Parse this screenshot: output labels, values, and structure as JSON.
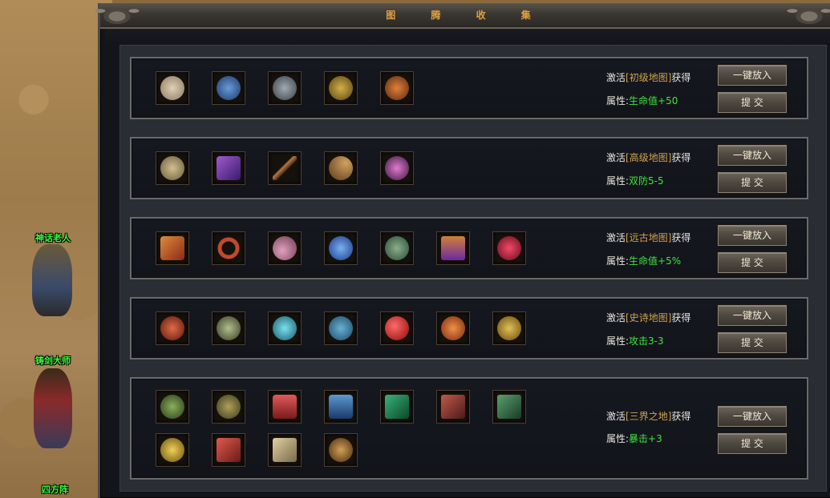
{
  "window": {
    "title": "图 腾 收 集"
  },
  "npcs": [
    {
      "name": "神话老人"
    },
    {
      "name": "铸剑大师"
    },
    {
      "name": "四方阵"
    }
  ],
  "labels": {
    "activate_prefix": "激活",
    "activate_suffix": "获得",
    "attr_prefix": "属性:"
  },
  "buttons": {
    "put_all": "一键放入",
    "submit": "提 交"
  },
  "sections": [
    {
      "map": "[初级地图]",
      "attr": "生命值+50",
      "items": [
        {
          "icon": "bone-icon",
          "color": "#c8b49a"
        },
        {
          "icon": "dragon-claw-icon",
          "color": "#3d6fb0"
        },
        {
          "icon": "claw-icon",
          "color": "#7a8590"
        },
        {
          "icon": "golden-beast-icon",
          "color": "#a88a2a"
        },
        {
          "icon": "eye-icon",
          "color": "#b0602a"
        }
      ]
    },
    {
      "map": "[高级地图]",
      "attr": "双防5-5",
      "items": [
        {
          "icon": "spiral-icon",
          "color": "#a09070"
        },
        {
          "icon": "scroll-icon",
          "color": "#7a3aa8"
        },
        {
          "icon": "sword-icon",
          "color": "#8a5a32"
        },
        {
          "icon": "horn-icon",
          "color": "#9a7a4a"
        },
        {
          "icon": "mask-icon",
          "color": "#b05aa8"
        }
      ]
    },
    {
      "map": "[远古地图]",
      "attr": "生命值+5%",
      "items": [
        {
          "icon": "red-scroll-icon",
          "color": "#c0502a"
        },
        {
          "icon": "ring-icon",
          "color": "#a04030"
        },
        {
          "icon": "worm-icon",
          "color": "#c08aa8"
        },
        {
          "icon": "blue-orb-icon",
          "color": "#3a7ad0"
        },
        {
          "icon": "green-shield-icon",
          "color": "#5a8a5a"
        },
        {
          "icon": "purple-banner-icon",
          "color": "#8a4ab0"
        },
        {
          "icon": "red-star-icon",
          "color": "#c02a4a"
        }
      ]
    },
    {
      "map": "[史诗地图]",
      "attr": "攻击3-3",
      "items": [
        {
          "icon": "red-emblem-icon",
          "color": "#b03a2a"
        },
        {
          "icon": "skull-icon",
          "color": "#7a8a5a"
        },
        {
          "icon": "cyan-orb-icon",
          "color": "#3ab0c0"
        },
        {
          "icon": "blue-dragon-coin-icon",
          "color": "#3a8ab0"
        },
        {
          "icon": "red-orb-icon",
          "color": "#d02a2a"
        },
        {
          "icon": "orange-dragon-coin-icon",
          "color": "#d0602a"
        },
        {
          "icon": "golden-lion-coin-icon",
          "color": "#b0902a"
        }
      ]
    },
    {
      "map": "[三界之地]",
      "attr": "暴击+3",
      "items": [
        {
          "icon": "green-serpent-icon",
          "color": "#5a8a3a"
        },
        {
          "icon": "gold-serpent-icon",
          "color": "#8a7a3a"
        },
        {
          "icon": "red-bottle-icon",
          "color": "#c03a3a"
        },
        {
          "icon": "blue-bottle-icon",
          "color": "#3a7ab0"
        },
        {
          "icon": "green-card-icon",
          "color": "#2a8a5a"
        },
        {
          "icon": "red-card-icon",
          "color": "#a03a3a"
        },
        {
          "icon": "green-book-icon",
          "color": "#3a7a4a"
        },
        {
          "icon": "gold-knot-icon",
          "color": "#c0a02a"
        },
        {
          "icon": "red-book-icon",
          "color": "#c03a3a"
        },
        {
          "icon": "parchment-icon",
          "color": "#c8b48a"
        },
        {
          "icon": "twin-dragon-icon",
          "color": "#b08a3a"
        }
      ]
    }
  ]
}
